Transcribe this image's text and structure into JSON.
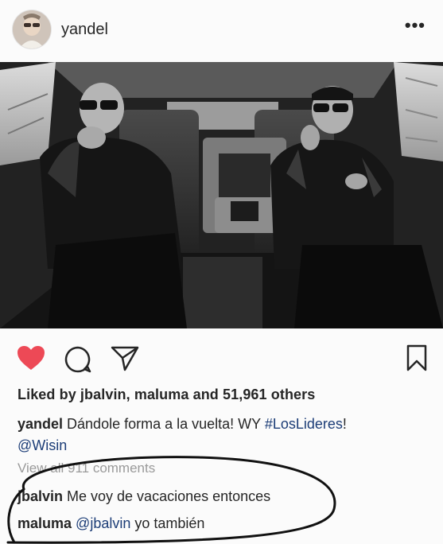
{
  "header": {
    "username": "yandel",
    "more_icon": "more-horizontal-icon"
  },
  "post": {
    "photo_description_icon": "photo",
    "likes": {
      "prefix": "Liked by ",
      "user1": "jbalvin",
      "sep": ", ",
      "user2": "maluma",
      "and": " and ",
      "count": "51,961 others"
    },
    "caption": {
      "user": "yandel",
      "text": " Dándole forma a la vuelta! WY ",
      "hashtag": "#LosLideres",
      "after": "! ",
      "mention": "@Wisin"
    },
    "view_all": "View all 911 comments",
    "comments": [
      {
        "user": "jbalvin",
        "text": " Me voy de vacaciones entonces"
      },
      {
        "user": "maluma",
        "mention": "@jbalvin",
        "text": " yo también"
      }
    ]
  },
  "colors": {
    "like_red": "#ed4956",
    "link_blue": "#1c3d77",
    "ink": "#111111"
  }
}
